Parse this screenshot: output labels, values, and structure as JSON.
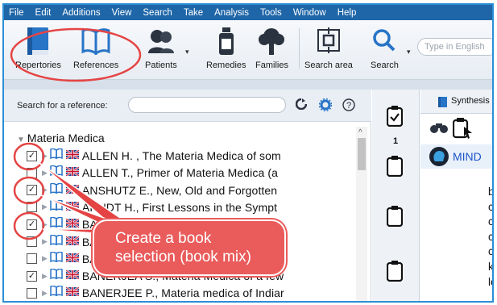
{
  "menu": [
    "File",
    "Edit",
    "Additions",
    "View",
    "Search",
    "Take",
    "Analysis",
    "Tools",
    "Window",
    "Help"
  ],
  "toolbar": {
    "repertories": "Repertories",
    "references": "References",
    "patients": "Patients",
    "remedies": "Remedies",
    "families": "Families",
    "search_area": "Search area",
    "search": "Search",
    "search_placeholder": "Type in English"
  },
  "reference_search": {
    "label": "Search for a reference:"
  },
  "tree": {
    "root": "Materia Medica",
    "rows": [
      {
        "checked": true,
        "text": "ALLEN H. , The Materia Medica of som"
      },
      {
        "checked": false,
        "text": "ALLEN T., Primer of Materia Medica (a"
      },
      {
        "checked": true,
        "text": "ANSHUTZ E., New, Old and Forgotten"
      },
      {
        "checked": false,
        "text": "ARNDT H., First Lessons in the Sympt"
      },
      {
        "checked": true,
        "text": "BANERJEA S., Pathology (l"
      },
      {
        "checked": false,
        "text": "BANERJEA S., Exotic India"
      },
      {
        "checked": false,
        "text": "BANERJEA S., Made ea"
      },
      {
        "checked": true,
        "text": "BANERJEA S., Materia Medica of a few"
      },
      {
        "checked": false,
        "text": "BANERJEE P., Materia medica of Indiar"
      }
    ]
  },
  "clipboard": {
    "active_number": "1"
  },
  "synthesis": {
    "tab_label": "Synthesis",
    "mind_label": "MIND",
    "side_letters": [
      "b",
      "c",
      "c",
      "c",
      "c",
      "k",
      "le"
    ]
  },
  "annotation": {
    "text_line1": "Create a book",
    "text_line2": "selection (book mix)",
    "color": "#e54444"
  }
}
